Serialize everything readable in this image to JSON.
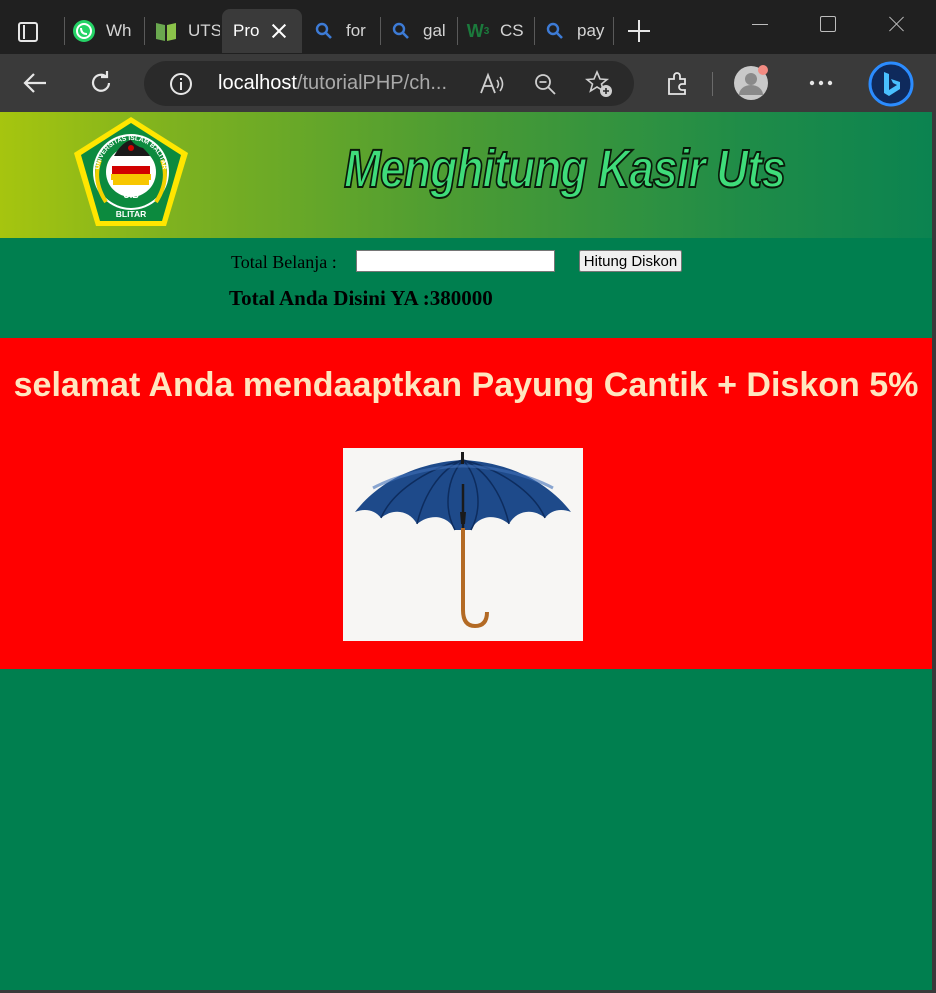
{
  "browser": {
    "tabs": [
      {
        "label": "Wh",
        "icon": "whatsapp-icon"
      },
      {
        "label": "UTS",
        "icon": "book-icon"
      },
      {
        "label": "Pro",
        "icon": "none",
        "active": true
      },
      {
        "label": "for",
        "icon": "search-icon"
      },
      {
        "label": "gal",
        "icon": "search-icon"
      },
      {
        "label": "CS",
        "icon": "w3schools-icon"
      },
      {
        "label": "pay",
        "icon": "search-icon"
      }
    ],
    "address": {
      "host": "localhost",
      "path": "/tutorialPHP/ch..."
    }
  },
  "page": {
    "banner_title": "Menghitung Kasir Uts",
    "logo": {
      "top_text": "UNIVERSITAS ISLAM BALITAR",
      "abbr": "UIB",
      "city": "BLITAR"
    },
    "form": {
      "label": "Total Belanja :",
      "input_value": "",
      "button_label": "Hitung Diskon"
    },
    "result_text": "Total Anda Disini YA :380000",
    "promo_text": "selamat Anda mendaaptkan Payung Cantik + Diskon 5%",
    "promo_image": "umbrella-image"
  },
  "colors": {
    "page_bg": "#007f4f",
    "promo_bg": "#ff0000",
    "promo_text": "#ffe6bf",
    "title_fill": "#3fdc7a"
  }
}
